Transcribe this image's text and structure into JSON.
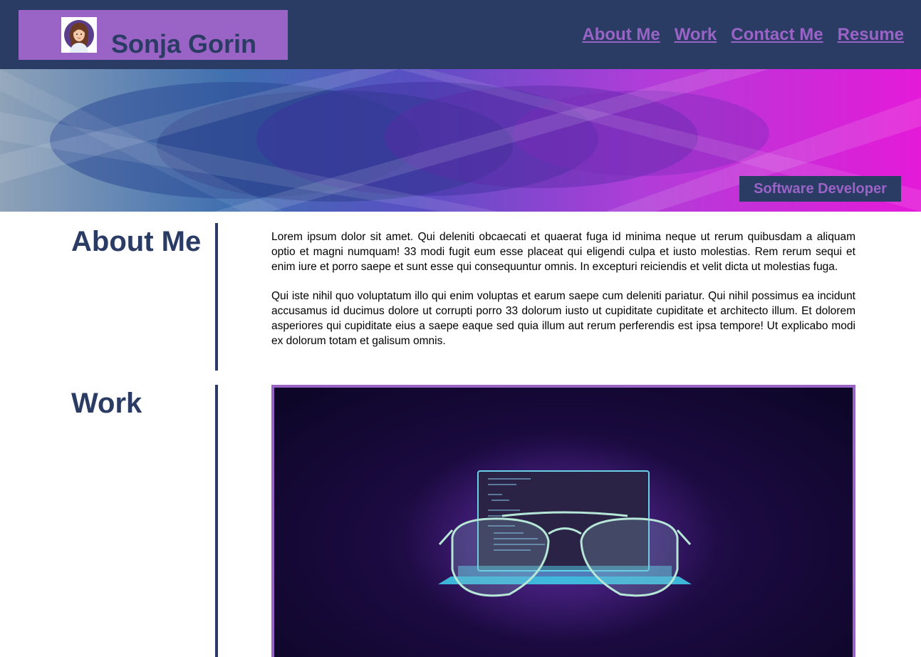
{
  "header": {
    "name": "Sonja Gorin",
    "avatar_icon": "avatar-icon",
    "nav": [
      {
        "label": "About Me"
      },
      {
        "label": "Work"
      },
      {
        "label": "Contact Me"
      },
      {
        "label": "Resume"
      }
    ]
  },
  "hero": {
    "tagline": "Software Developer"
  },
  "about": {
    "title": "About Me",
    "paragraphs": [
      "Lorem ipsum dolor sit amet. Qui deleniti obcaecati et quaerat fuga id minima neque ut rerum quibusdam a aliquam optio et magni numquam! 33 modi fugit eum esse placeat qui eligendi culpa et iusto molestias. Rem rerum sequi et enim iure et porro saepe et sunt esse qui consequuntur omnis. In excepturi reiciendis et velit dicta ut molestias fuga.",
      "Qui iste nihil quo voluptatum illo qui enim voluptas et earum saepe cum deleniti pariatur. Qui nihil possimus ea incidunt accusamus id ducimus dolore ut corrupti porro 33 dolorum iusto ut cupiditate cupiditate et architecto illum. Et dolorem asperiores qui cupiditate eius a saepe eaque sed quia illum aut rerum perferendis est ipsa tempore! Ut explicabo modi ex dolorum totam et galisum omnis."
    ]
  },
  "work": {
    "title": "Work",
    "image_icon": "laptop-glasses-illustration"
  },
  "colors": {
    "navy": "#2a3b64",
    "purple": "#9a63c6",
    "magenta": "#e41ad8"
  }
}
